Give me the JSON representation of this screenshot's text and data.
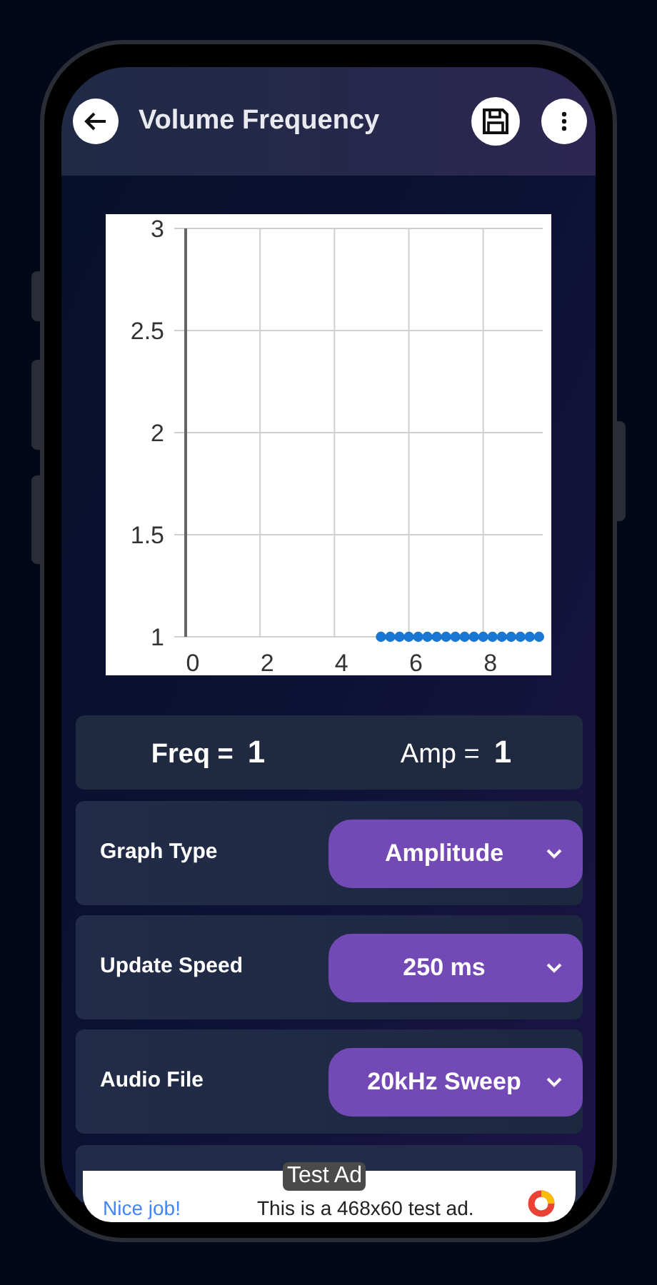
{
  "app_bar": {
    "title": "Volume Frequency"
  },
  "chart": {
    "chart_data": {
      "type": "scatter",
      "x": [
        5.25,
        5.5,
        5.75,
        6,
        6.25,
        6.5,
        6.75,
        7,
        7.25,
        7.5,
        7.75,
        8,
        8.25,
        8.5,
        8.75,
        9,
        9.25,
        9.5
      ],
      "series": [
        {
          "color": "#1976d2",
          "values": [
            1,
            1,
            1,
            1,
            1,
            1,
            1,
            1,
            1,
            1,
            1,
            1,
            1,
            1,
            1,
            1,
            1,
            1
          ]
        }
      ],
      "grid": true,
      "xlim": [
        0,
        9.6
      ],
      "ylim": [
        1,
        3
      ],
      "xticks": [
        0,
        2,
        4,
        6,
        8
      ],
      "yticks": [
        1,
        1.5,
        2,
        2.5,
        3
      ]
    }
  },
  "readout": {
    "freq_label": "Freq =",
    "freq_value": "1",
    "amp_label": "Amp =",
    "amp_value": "1"
  },
  "settings": [
    {
      "label": "Graph Type",
      "value": "Amplitude"
    },
    {
      "label": "Update Speed",
      "value": "250 ms"
    },
    {
      "label": "Audio File",
      "value": "20kHz Sweep"
    }
  ],
  "ad": {
    "badge": "Test Ad",
    "headline": "Nice job!",
    "text": "This is a 468x60 test ad."
  }
}
